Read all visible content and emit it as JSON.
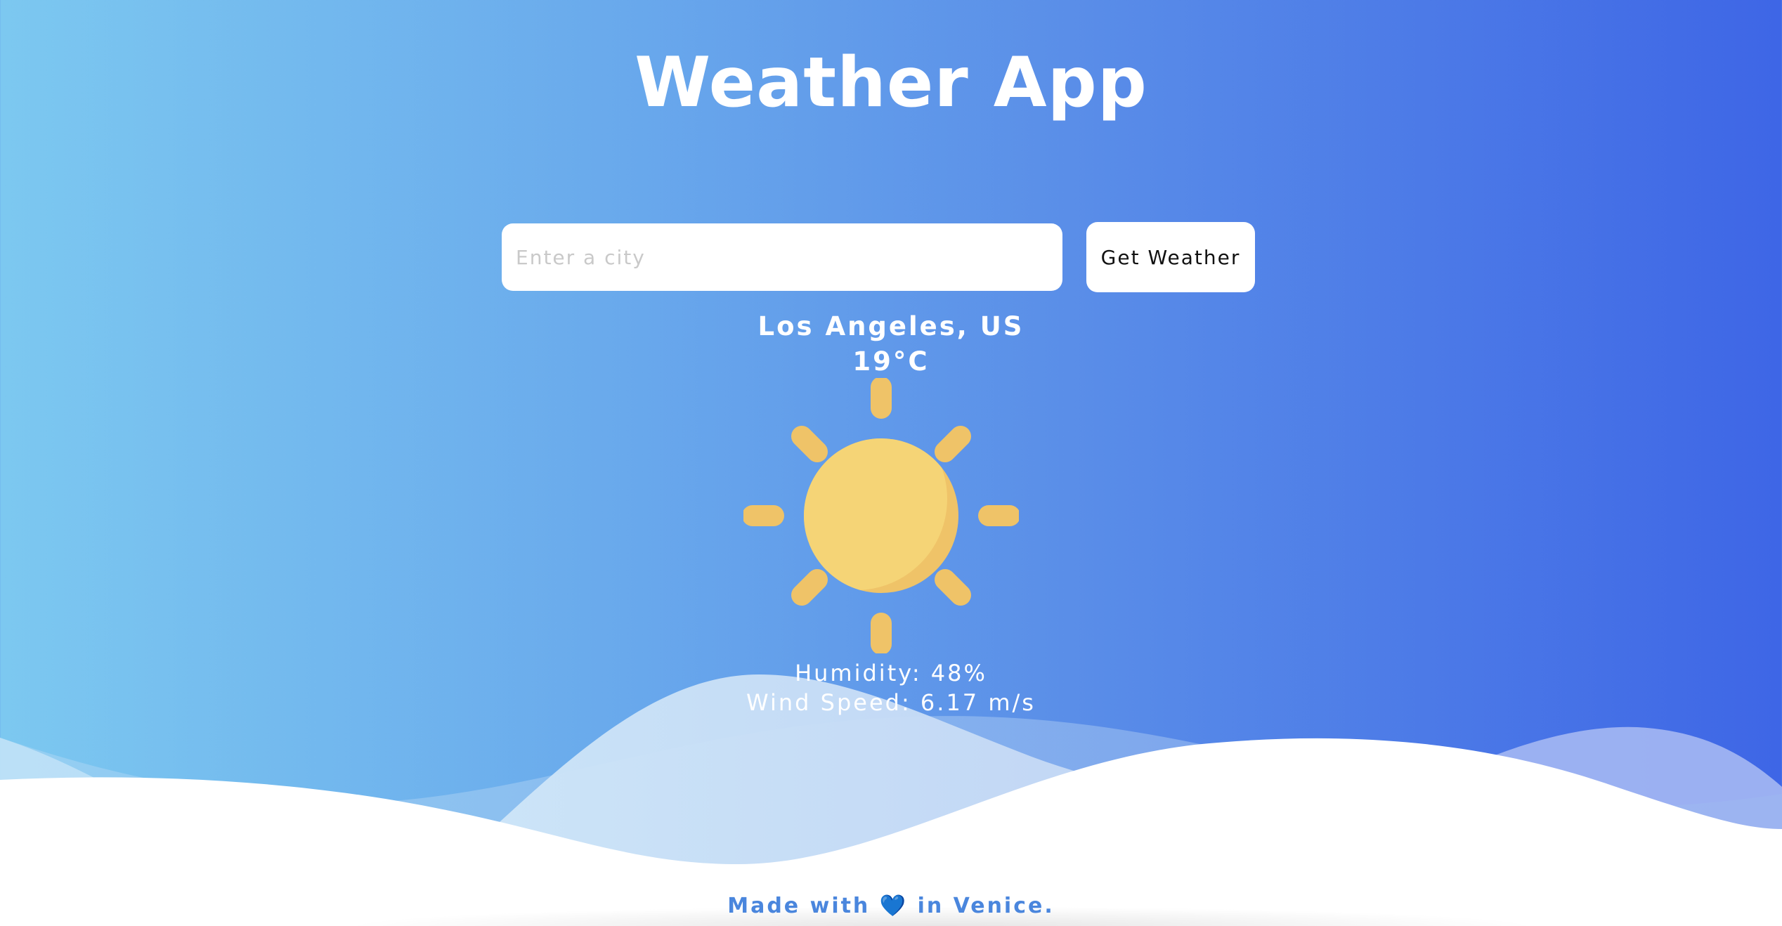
{
  "app": {
    "title": "Weather App"
  },
  "search": {
    "placeholder": "Enter a city",
    "value": "",
    "button_label": "Get Weather"
  },
  "weather": {
    "location": "Los Angeles, US",
    "temperature": "19°C",
    "icon": "sun-icon",
    "humidity": "Humidity: 48%",
    "wind_speed": "Wind Speed: 6.17 m/s"
  },
  "footer": {
    "text_before": "Made with",
    "heart": "💙",
    "text_after": "in Venice."
  },
  "colors": {
    "gradient_start": "#7cc8f0",
    "gradient_end": "#3e66e6",
    "sun_body": "#f5d476",
    "sun_shade": "#efc368",
    "footer_text": "#4a86dd"
  }
}
